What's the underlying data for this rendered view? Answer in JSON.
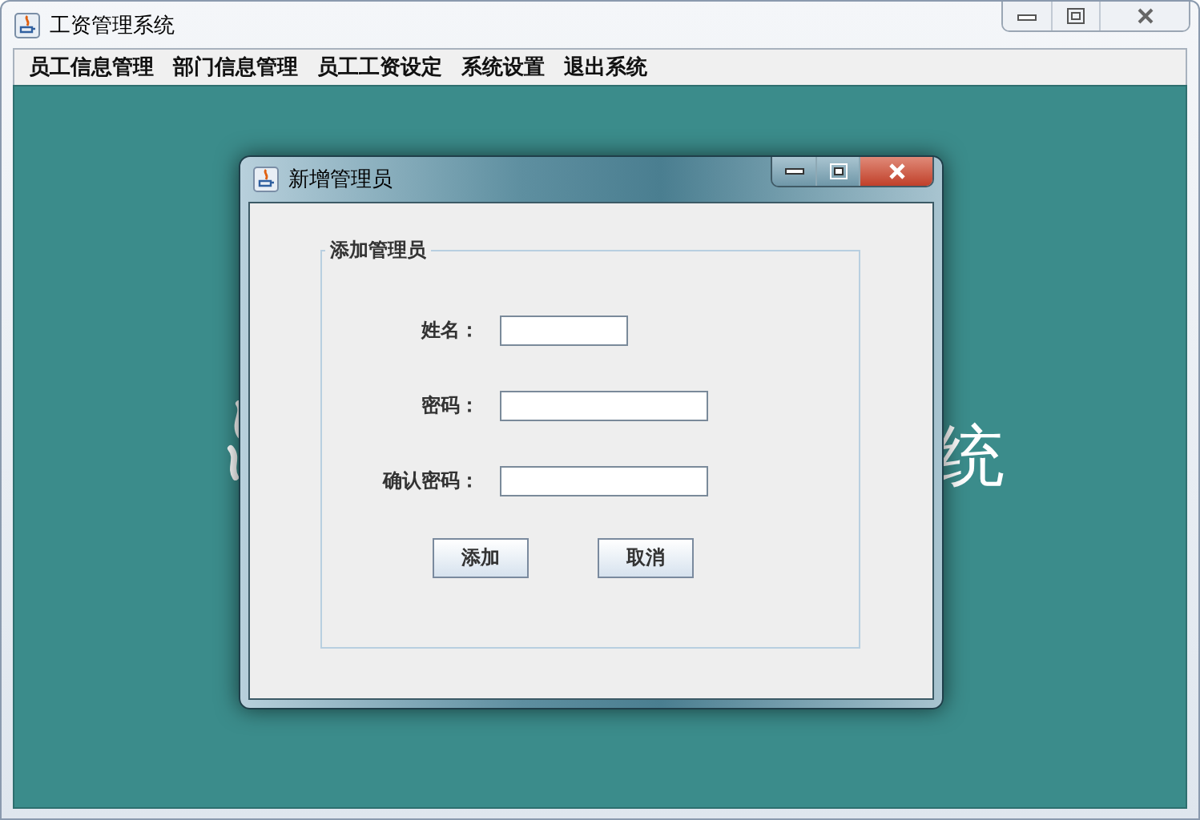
{
  "window": {
    "title": "工资管理系统"
  },
  "menu": [
    {
      "label": "员工信息管理"
    },
    {
      "label": "部门信息管理"
    },
    {
      "label": "员工工资设定"
    },
    {
      "label": "系统设置"
    },
    {
      "label": "退出系统"
    }
  ],
  "background_text": "统",
  "dialog": {
    "title": "新增管理员",
    "group_title": "添加管理员",
    "fields": [
      {
        "label": "姓名：",
        "kind": "short"
      },
      {
        "label": "密码：",
        "kind": "long"
      },
      {
        "label": "确认密码：",
        "kind": "long"
      }
    ],
    "buttons": [
      "添加",
      "取消"
    ]
  }
}
